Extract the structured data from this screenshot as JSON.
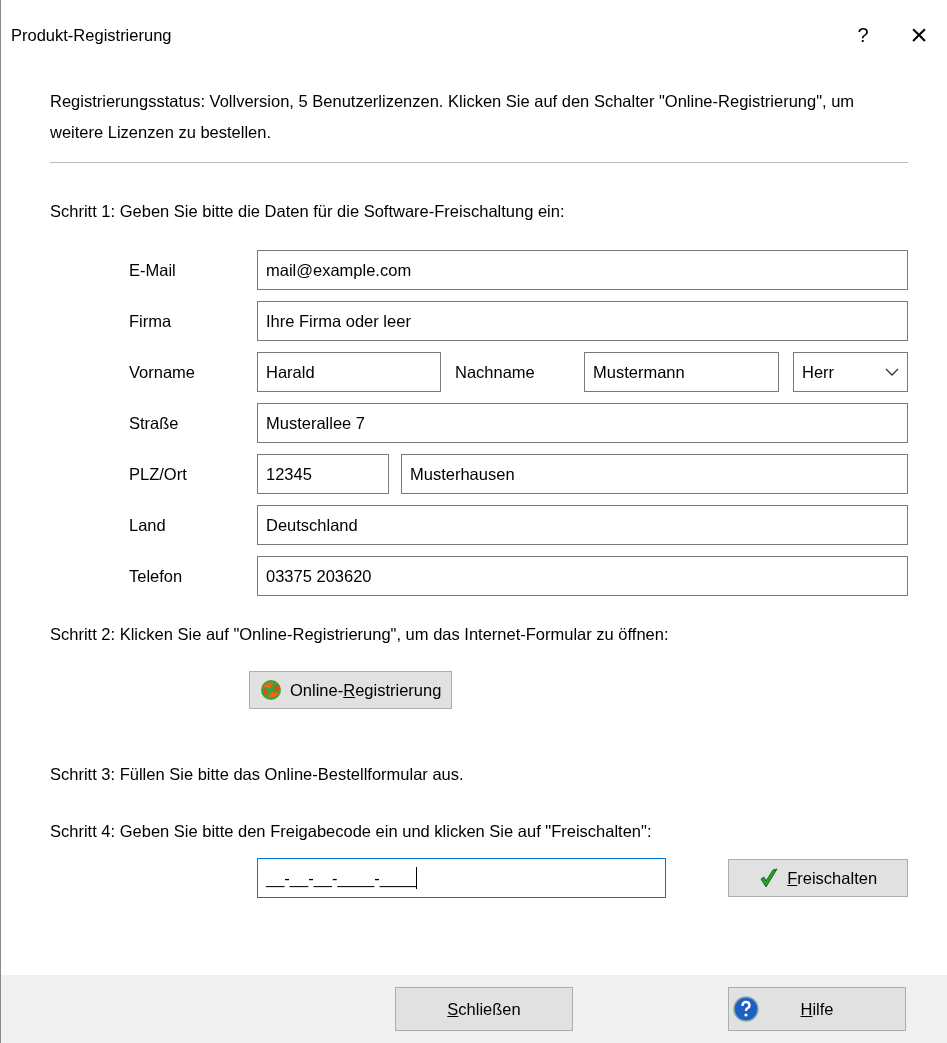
{
  "window": {
    "title": "Produkt-Registrierung",
    "help_glyph": "?",
    "close_glyph": "×"
  },
  "status_text": "Registrierungsstatus: Vollversion, 5 Benutzerlizenzen. Klicken Sie auf den Schalter \"Online-Registrierung\", um weitere Lizenzen zu bestellen.",
  "step1": "Schritt 1: Geben Sie bitte die Daten für die Software-Freischaltung ein:",
  "form_rows": [
    {
      "kind": "single",
      "label": "E-Mail",
      "fields": [
        {
          "kind": "text",
          "value": "mail@example.com"
        }
      ]
    },
    {
      "kind": "single",
      "label": "Firma",
      "fields": [
        {
          "kind": "text",
          "value": "Ihre Firma oder leer"
        }
      ]
    },
    {
      "kind": "name",
      "label": "Vorname",
      "fields": [
        {
          "kind": "text",
          "value": "Harald"
        },
        {
          "kind": "label",
          "text": "Nachname"
        },
        {
          "kind": "text",
          "value": "Mustermann"
        },
        {
          "kind": "combo",
          "value": "Herr"
        }
      ]
    },
    {
      "kind": "single",
      "label": "Straße",
      "fields": [
        {
          "kind": "text",
          "value": "Musterallee 7"
        }
      ]
    },
    {
      "kind": "plz",
      "label": "PLZ/Ort",
      "fields": [
        {
          "kind": "text",
          "value": "12345"
        },
        {
          "kind": "text",
          "value": "Musterhausen"
        }
      ]
    },
    {
      "kind": "single",
      "label": "Land",
      "fields": [
        {
          "kind": "text",
          "value": "Deutschland"
        }
      ]
    },
    {
      "kind": "single",
      "label": "Telefon",
      "fields": [
        {
          "kind": "text",
          "value": "03375 203620"
        }
      ]
    }
  ],
  "step2": "Schritt 2: Klicken Sie auf \"Online-Registrierung\", um das Internet-Formular zu öffnen:",
  "online_button": {
    "before": "Online-",
    "access_key": "R",
    "after": "egistrierung"
  },
  "step3": "Schritt 3: Füllen Sie bitte das Online-Bestellformular aus.",
  "step4": "Schritt 4: Geben Sie bitte den Freigabecode ein und klicken Sie auf \"Freischalten\":",
  "code_field": {
    "value": "__-__-__-____-____",
    "focused": true
  },
  "unlock_button": {
    "access_key": "F",
    "after": "reischalten"
  },
  "footer_buttons": [
    {
      "kind": "close",
      "access_key": "S",
      "after": "chließen"
    },
    {
      "kind": "help",
      "access_key": "H",
      "after": "ilfe"
    }
  ]
}
